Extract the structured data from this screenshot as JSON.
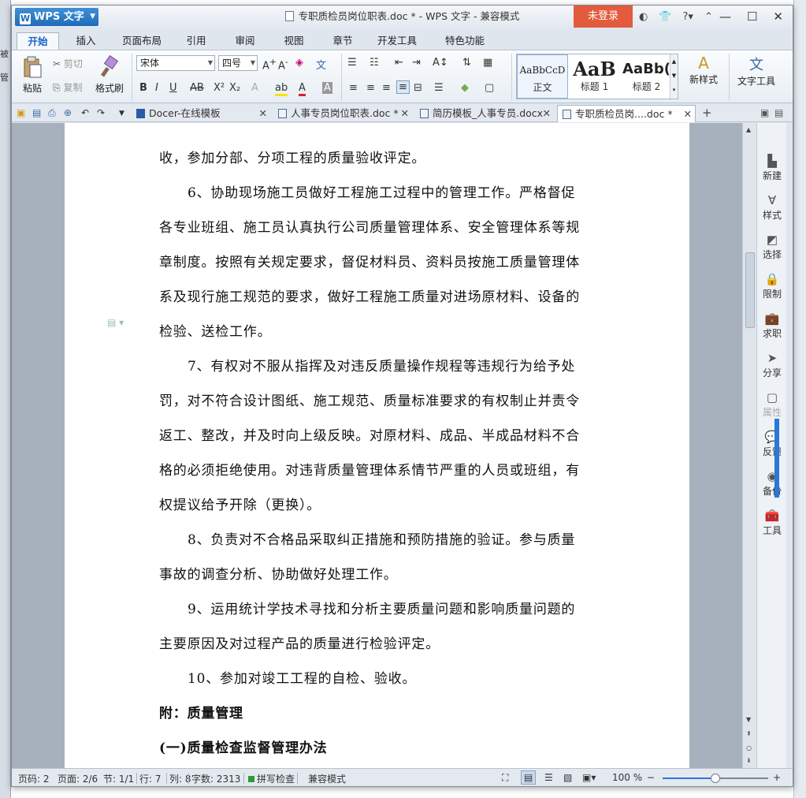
{
  "desktop": {
    "left_text_1": "被",
    "left_text_2": "管"
  },
  "window": {
    "app_button": "WPS 文字",
    "title": "专职质检员岗位职表.doc * - WPS 文字 - 兼容模式",
    "login": "未登录"
  },
  "ribbon_tabs": [
    "开始",
    "插入",
    "页面布局",
    "引用",
    "审阅",
    "视图",
    "章节",
    "开发工具",
    "特色功能"
  ],
  "ribbon": {
    "paste": "粘贴",
    "cut": "剪切",
    "copy": "复制",
    "format_painter": "格式刷",
    "font_name": "宋体",
    "font_size": "四号",
    "styles": [
      {
        "preview": "AaBbCcD",
        "label": "正文"
      },
      {
        "preview": "AaB",
        "label": "标题 1"
      },
      {
        "preview": "AaBb(",
        "label": "标题 2"
      }
    ],
    "new_style": "新样式",
    "text_tools": "文字工具"
  },
  "doc_tabs": [
    {
      "label": "Docer-在线模板"
    },
    {
      "label": "人事专员岗位职表.doc *"
    },
    {
      "label": "简历模板_人事专员.docx"
    },
    {
      "label": "专职质检员岗....doc *"
    }
  ],
  "document": {
    "lines": [
      "收，参加分部、分项工程的质量验收评定。",
      "6、协助现场施工员做好工程施工过程中的管理工作。严格督促",
      "各专业班组、施工员认真执行公司质量管理体系、安全管理体系等规",
      "章制度。按照有关规定要求，督促材料员、资料员按施工质量管理体",
      "系及现行施工规范的要求，做好工程施工质量对进场原材料、设备的",
      "检验、送检工作。",
      "7、有权对不服从指挥及对违反质量操作规程等违规行为给予处",
      "罚，对不符合设计图纸、施工规范、质量标准要求的有权制止并责令",
      "返工、整改，并及时向上级反映。对原材料、成品、半成品材料不合",
      "格的必须拒绝使用。对违背质量管理体系情节严重的人员或班组，有",
      "权提议给予开除（更换）。",
      "8、负责对不合格品采取纠正措施和预防措施的验证。参与质量",
      "事故的调查分析、协助做好处理工作。",
      "9、运用统计学技术寻找和分析主要质量问题和影响质量问题的",
      "主要原因及对过程产品的质量进行检验评定。",
      "10、参加对竣工工程的自检、验收。",
      "附：质量管理",
      "(一)质量检查监督管理办法"
    ]
  },
  "task_pane": [
    "新建",
    "样式",
    "选择",
    "限制",
    "求职",
    "分享",
    "属性",
    "反馈",
    "备份",
    "工具"
  ],
  "status": {
    "page_code": "页码: 2",
    "page": "页面: 2/6",
    "section": "节: 1/1",
    "row": "行: 7",
    "col": "列: 8",
    "chars": "字数: 2313",
    "spell": "拼写检查",
    "compat": "兼容模式",
    "zoom": "100 %",
    "zoom_fraction": 0.5
  }
}
